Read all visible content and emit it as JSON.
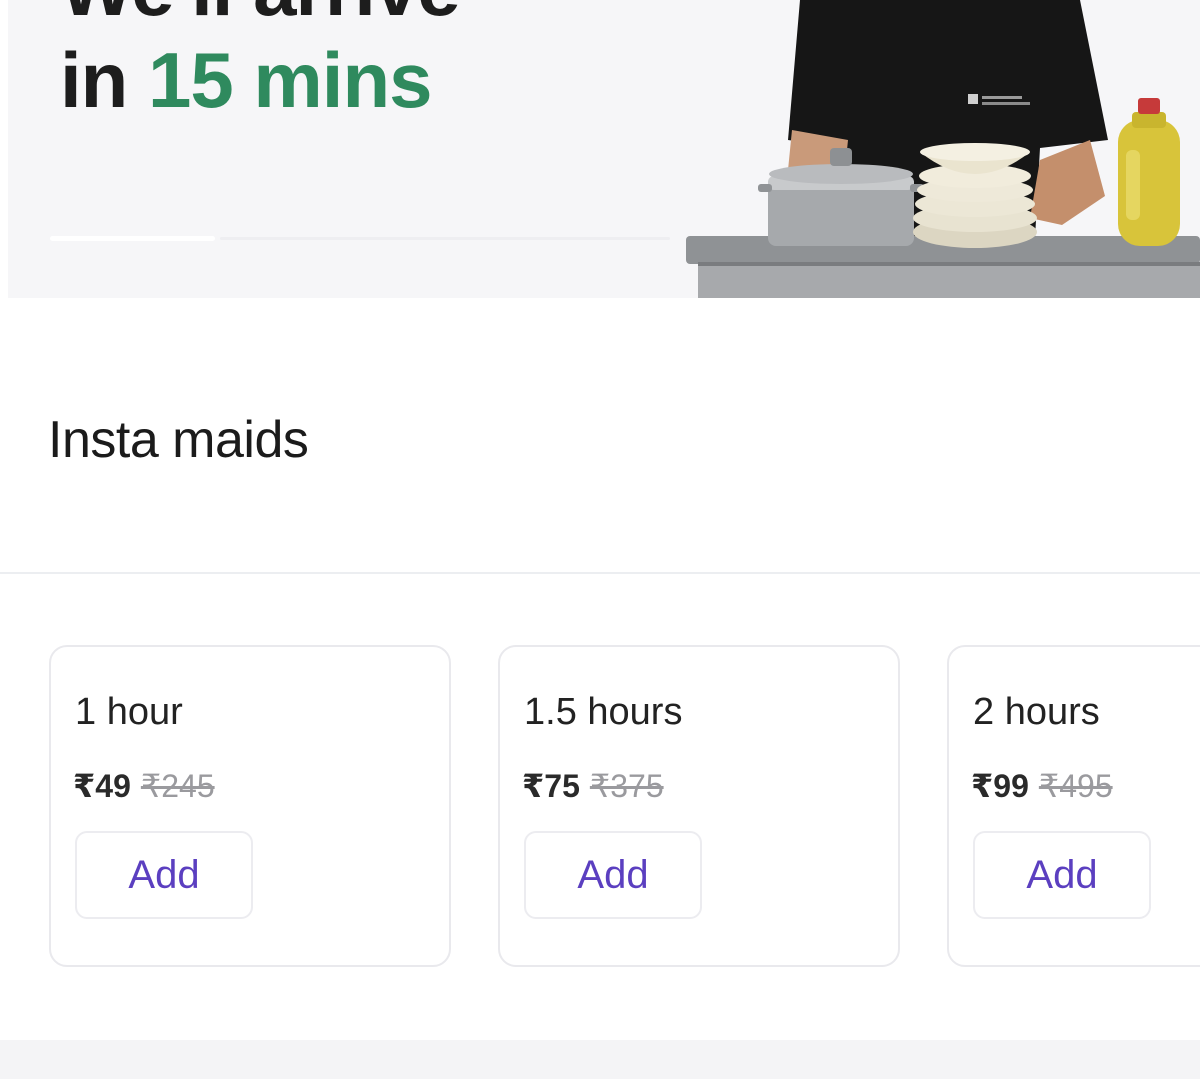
{
  "hero": {
    "title_line1": "We'll arrive",
    "title_line2_prefix": "in ",
    "title_line2_accent": "15 mins",
    "accent_color": "#2f8a5e"
  },
  "section": {
    "title": "Insta maids"
  },
  "packages": [
    {
      "duration": "1 hour",
      "price": "₹49",
      "original_price": "₹245",
      "button_label": "Add"
    },
    {
      "duration": "1.5 hours",
      "price": "₹75",
      "original_price": "₹375",
      "button_label": "Add"
    },
    {
      "duration": "2 hours",
      "price": "₹99",
      "original_price": "₹495",
      "button_label": "Add"
    }
  ],
  "colors": {
    "button_text": "#5b3fc0",
    "strike_price": "#9a9a9e"
  }
}
